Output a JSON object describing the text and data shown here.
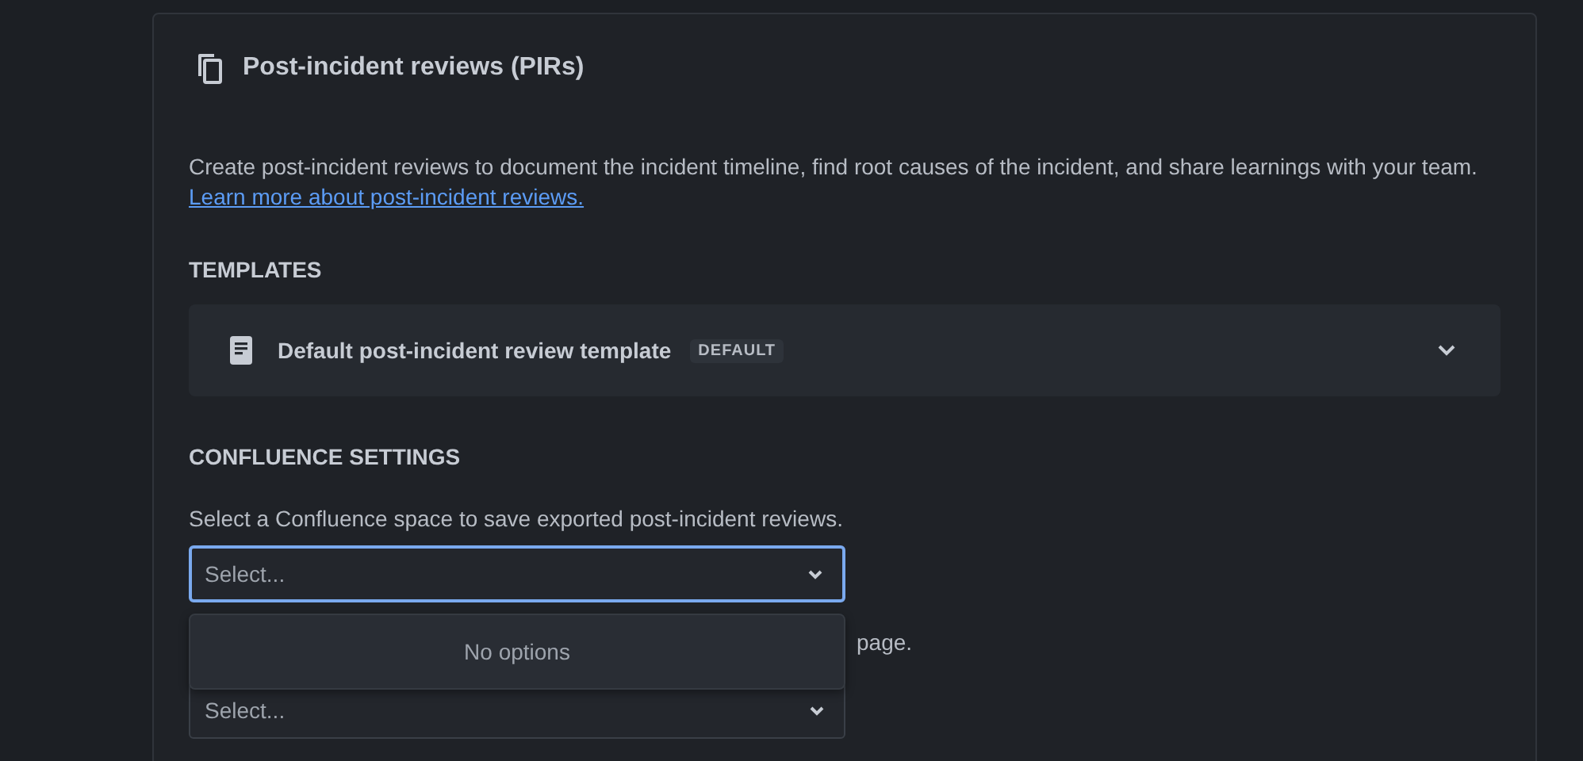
{
  "section": {
    "title": "Post-incident reviews (PIRs)",
    "description": "Create post-incident reviews to document the incident timeline, find root causes of the incident, and share learnings with your team.",
    "link": "Learn more about post-incident reviews."
  },
  "templates": {
    "heading": "TEMPLATES",
    "items": [
      {
        "name": "Default post-incident review template",
        "badge": "DEFAULT",
        "expanded": false
      }
    ]
  },
  "confluence": {
    "heading": "CONFLUENCE SETTINGS",
    "space_label": "Select a Confluence space to save exported post-incident reviews.",
    "space_select": {
      "placeholder": "Select...",
      "focused": true,
      "menu_text": "No options"
    },
    "page_label": "page.",
    "page_select": {
      "placeholder": "Select...",
      "focused": false
    }
  }
}
